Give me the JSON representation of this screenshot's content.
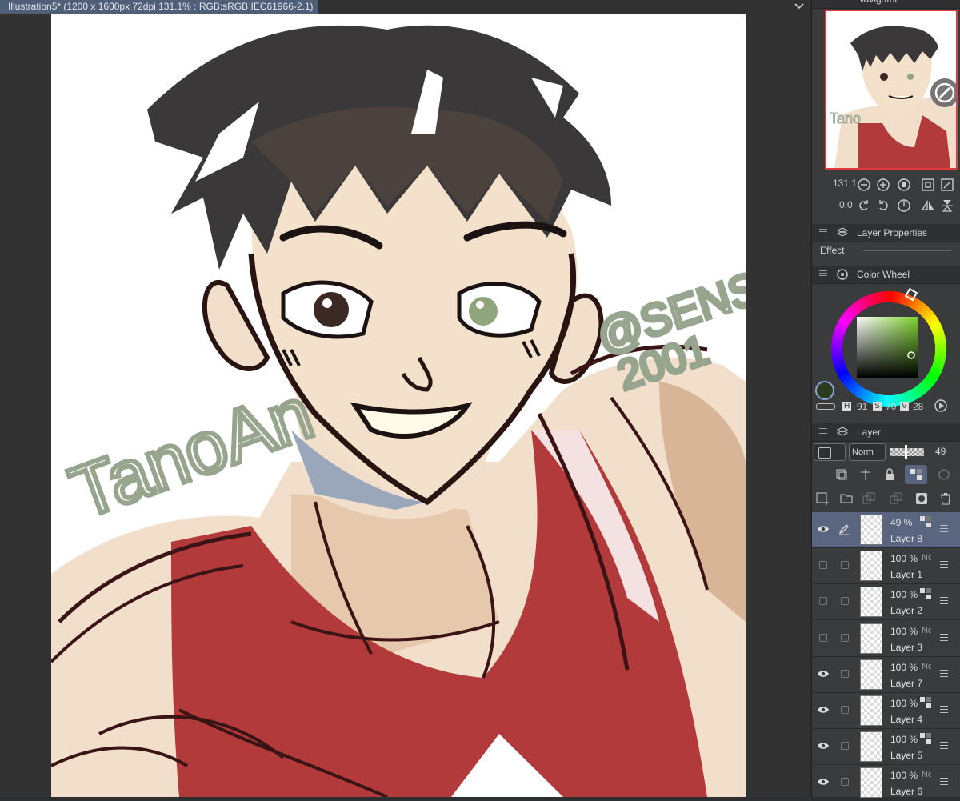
{
  "document": {
    "tab_title": "Illustration5* (1200 x 1600px 72dpi 131.1% : RGB:sRGB IEC61966-2.1)"
  },
  "canvas": {
    "signature_left": "TanoAn",
    "signature_right_line1": "@SENSE",
    "signature_right_line2": "2001"
  },
  "navigator": {
    "title": "Navigator",
    "zoom": "131.1",
    "rotation": "0.0"
  },
  "layer_properties": {
    "title": "Layer Properties",
    "effect_label": "Effect"
  },
  "color_wheel": {
    "title": "Color Wheel",
    "h_label": "H",
    "h_value": "91",
    "s_label": "S",
    "s_value": "70",
    "v_label": "V",
    "v_value": "28",
    "current_color": "#2b3b22"
  },
  "layer_palette": {
    "title": "Layer",
    "blend_mode": "Norm",
    "opacity": "49"
  },
  "layers": [
    {
      "name": "Layer 8",
      "opacity": "49 %",
      "blend": "",
      "visible": true,
      "selected": true
    },
    {
      "name": "Layer 1",
      "opacity": "100 %",
      "blend": "No",
      "visible": false,
      "selected": false
    },
    {
      "name": "Layer 2",
      "opacity": "100 %",
      "blend": "",
      "visible": false,
      "selected": false
    },
    {
      "name": "Layer 3",
      "opacity": "100 %",
      "blend": "No",
      "visible": false,
      "selected": false
    },
    {
      "name": "Layer 7",
      "opacity": "100 %",
      "blend": "No",
      "visible": true,
      "selected": false
    },
    {
      "name": "Layer 4",
      "opacity": "100 %",
      "blend": "",
      "visible": true,
      "selected": false
    },
    {
      "name": "Layer 5",
      "opacity": "100 %",
      "blend": "",
      "visible": true,
      "selected": false
    },
    {
      "name": "Layer 6",
      "opacity": "100 %",
      "blend": "No",
      "visible": true,
      "selected": false
    }
  ]
}
